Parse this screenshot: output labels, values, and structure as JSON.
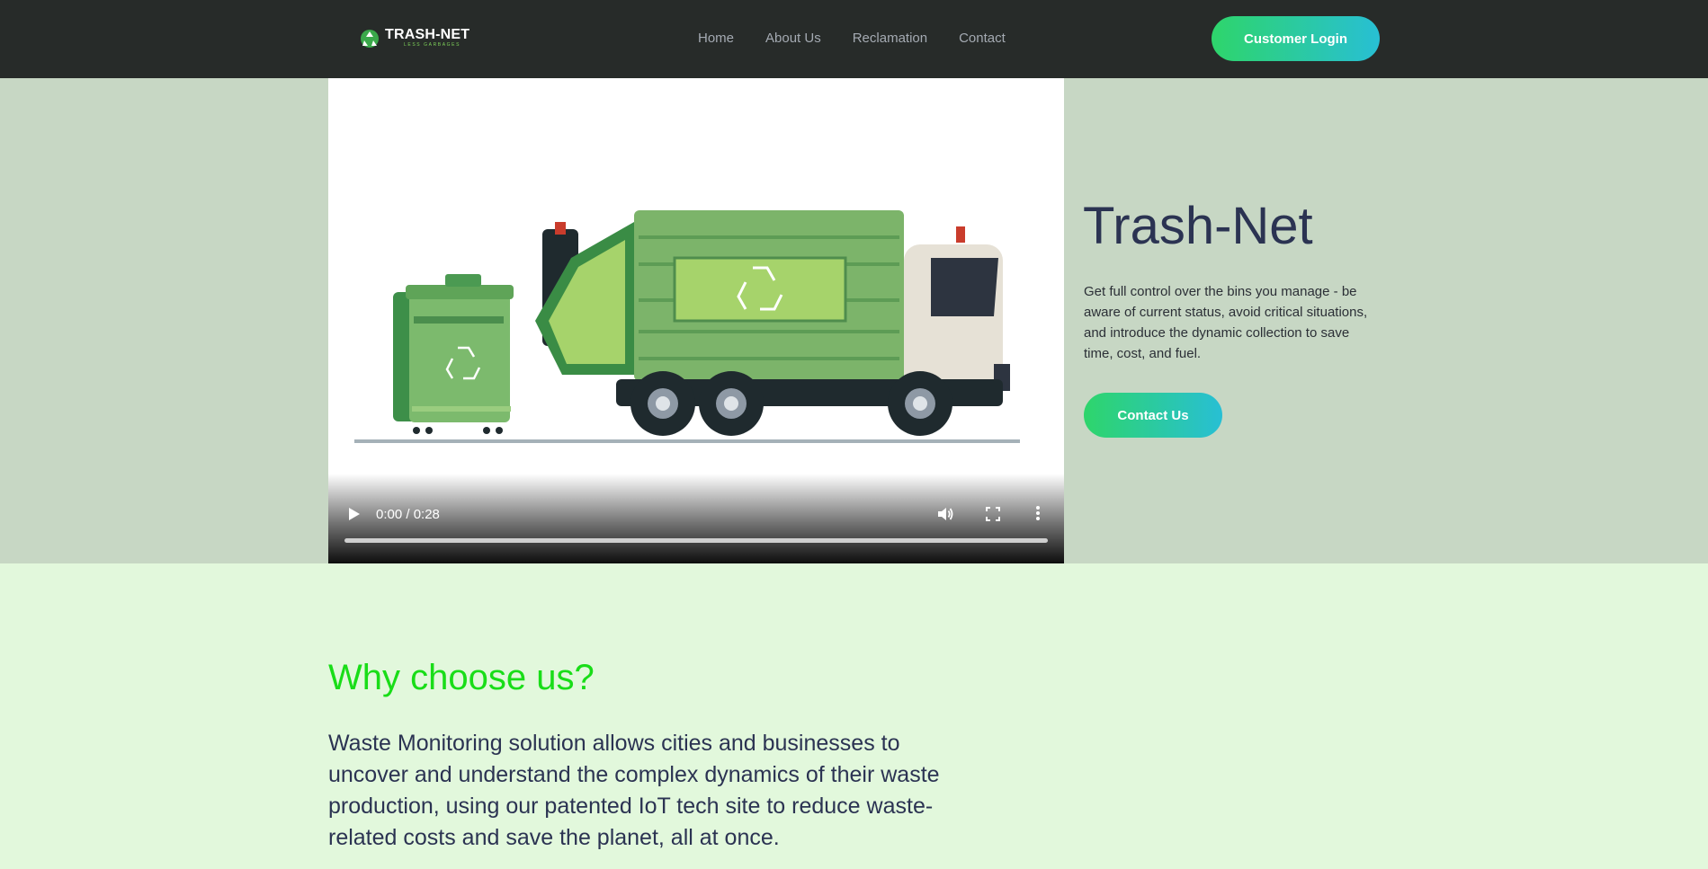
{
  "nav": {
    "logo_text": "TRASH-NET",
    "logo_sub": "LESS GARBAGES",
    "links": [
      "Home",
      "About Us",
      "Reclamation",
      "Contact"
    ],
    "login_label": "Customer Login"
  },
  "hero": {
    "video": {
      "time": "0:00 / 0:28"
    },
    "title": "Trash-Net",
    "description": "Get full control over the bins you manage - be aware of current status, avoid critical situations, and introduce the dynamic collection to save time, cost, and fuel.",
    "contact_label": "Contact Us"
  },
  "why": {
    "title": "Why choose us?",
    "text": "Waste Monitoring solution allows cities and businesses to uncover and understand the complex dynamics of their waste production, using our patented IoT tech site to reduce waste-related costs and save the planet, all at once."
  },
  "colors": {
    "nav_bg": "#272b29",
    "hero_bg": "#c7d7c4",
    "page_bg": "#e2f8dc",
    "accent_green": "#19dd18",
    "button_gradient_start": "#2ed56b",
    "button_gradient_end": "#28bfd4",
    "title_color": "#2b3352"
  },
  "icons": [
    "logo-icon",
    "play-icon",
    "volume-icon",
    "fullscreen-icon",
    "more-vert-icon",
    "recycle-icon"
  ]
}
